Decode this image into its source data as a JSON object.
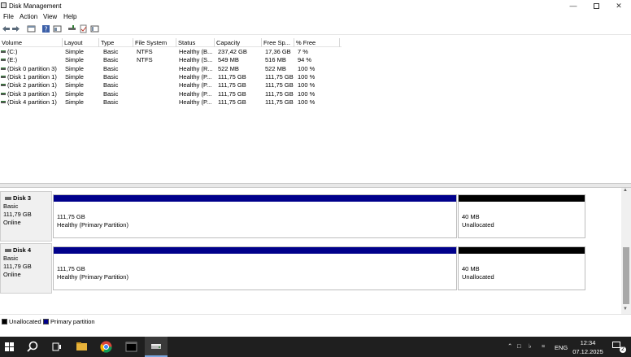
{
  "window": {
    "title": "Disk Management"
  },
  "menu": [
    "File",
    "Action",
    "View",
    "Help"
  ],
  "volume_table": {
    "columns": [
      "Volume",
      "Layout",
      "Type",
      "File System",
      "Status",
      "Capacity",
      "Free Sp...",
      "% Free"
    ],
    "rows": [
      [
        "(C:)",
        "Simple",
        "Basic",
        "NTFS",
        "Healthy (B...",
        "237,42 GB",
        "17,36 GB",
        "7 %"
      ],
      [
        "(E:)",
        "Simple",
        "Basic",
        "NTFS",
        "Healthy (S...",
        "549 MB",
        "516 MB",
        "94 %"
      ],
      [
        "(Disk 0 partition 3)",
        "Simple",
        "Basic",
        "",
        "Healthy (R...",
        "522 MB",
        "522 MB",
        "100 %"
      ],
      [
        "(Disk 1 partition 1)",
        "Simple",
        "Basic",
        "",
        "Healthy (P...",
        "111,75 GB",
        "111,75 GB",
        "100 %"
      ],
      [
        "(Disk 2 partition 1)",
        "Simple",
        "Basic",
        "",
        "Healthy (P...",
        "111,75 GB",
        "111,75 GB",
        "100 %"
      ],
      [
        "(Disk 3 partition 1)",
        "Simple",
        "Basic",
        "",
        "Healthy (P...",
        "111,75 GB",
        "111,75 GB",
        "100 %"
      ],
      [
        "(Disk 4 partition 1)",
        "Simple",
        "Basic",
        "",
        "Healthy (P...",
        "111,75 GB",
        "111,75 GB",
        "100 %"
      ]
    ]
  },
  "disks": [
    {
      "name": "Disk 3",
      "type": "Basic",
      "size": "111,79 GB",
      "status": "Online",
      "partitions": [
        {
          "size": "111,75 GB",
          "status": "Healthy (Primary Partition)",
          "color": "#00008b"
        },
        {
          "size": "40 MB",
          "status": "Unallocated",
          "color": "#000000"
        }
      ]
    },
    {
      "name": "Disk 4",
      "type": "Basic",
      "size": "111,79 GB",
      "status": "Online",
      "partitions": [
        {
          "size": "111,75 GB",
          "status": "Healthy (Primary Partition)",
          "color": "#00008b"
        },
        {
          "size": "40 MB",
          "status": "Unallocated",
          "color": "#000000"
        }
      ]
    }
  ],
  "legend": [
    {
      "label": "Unallocated",
      "color": "#000000"
    },
    {
      "label": "Primary partition",
      "color": "#00008b"
    }
  ],
  "taskbar": {
    "lang": "ENG",
    "time": "12:34",
    "date": "07.12.2025",
    "notifications": "2"
  }
}
